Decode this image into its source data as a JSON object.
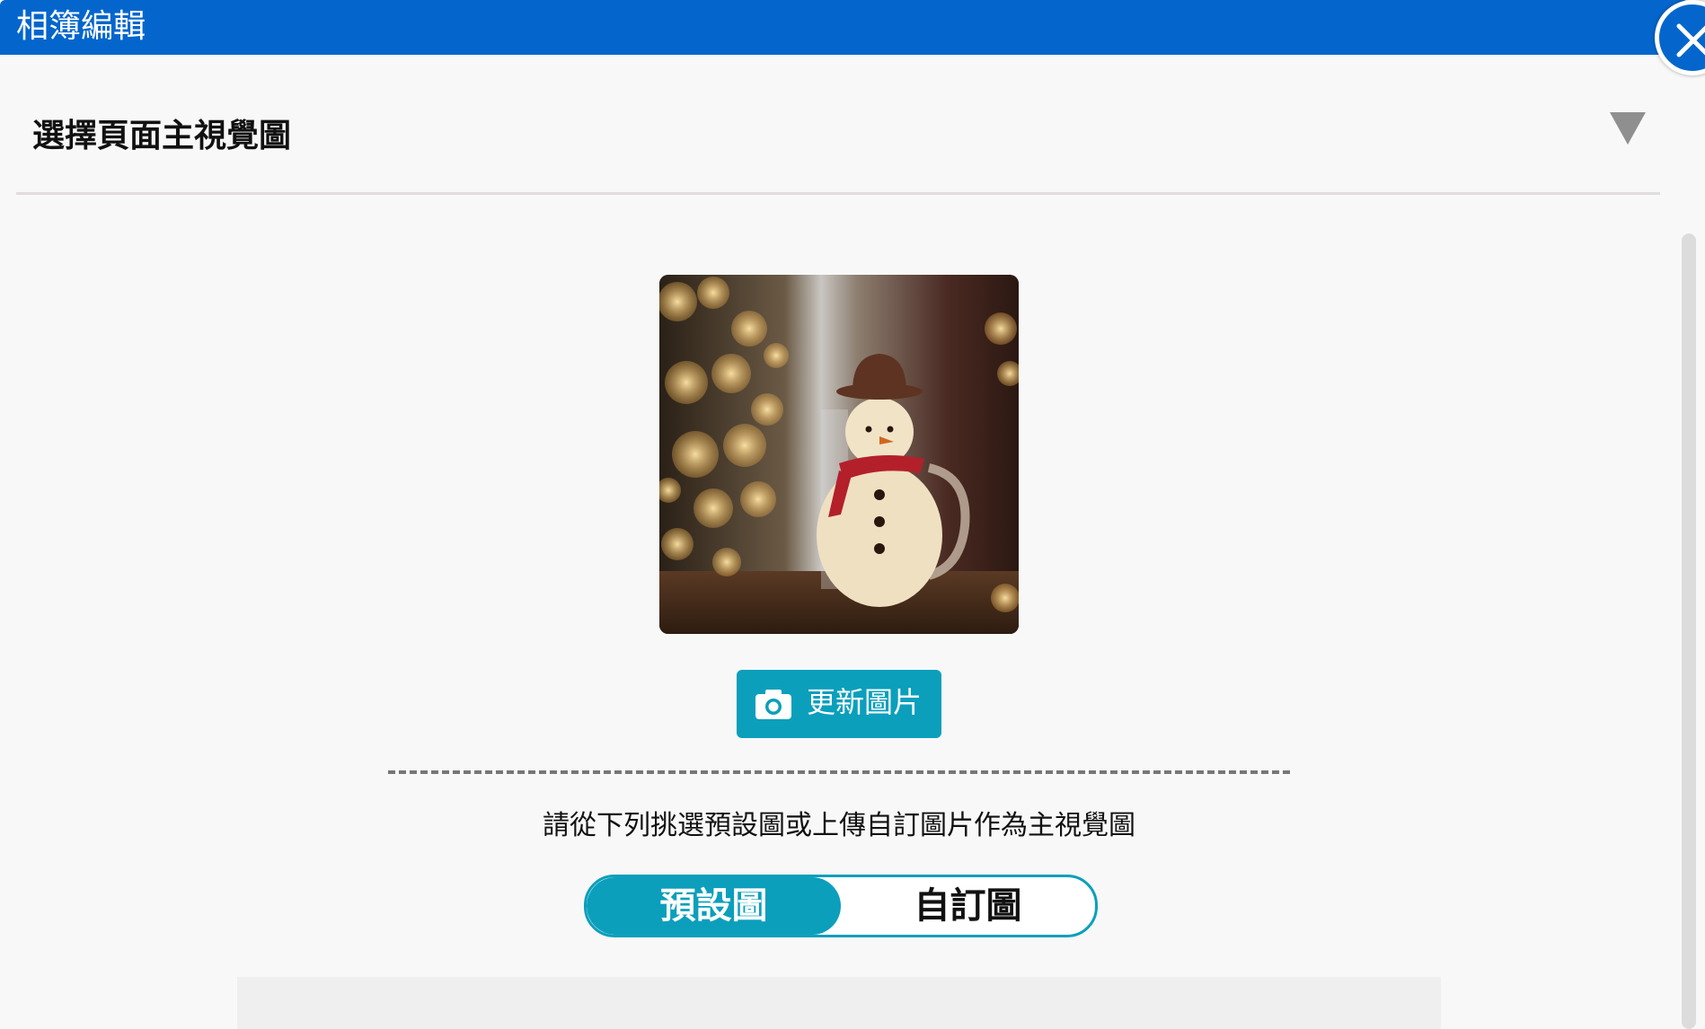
{
  "window": {
    "title": "相簿編輯"
  },
  "section": {
    "heading": "選擇頁面主視覺圖"
  },
  "update_button": {
    "label": "更新圖片"
  },
  "instruction": "請從下列挑選預設圖或上傳自訂圖片作為主視覺圖",
  "toggle": {
    "options": [
      {
        "label": "預設圖",
        "active": true
      },
      {
        "label": "自訂圖",
        "active": false
      }
    ]
  },
  "colors": {
    "titlebar": "#0466cc",
    "accent": "#0b9fbc",
    "background": "#f8f8f8"
  },
  "icons": [
    "close-icon",
    "chevron-down-icon",
    "camera-icon"
  ]
}
